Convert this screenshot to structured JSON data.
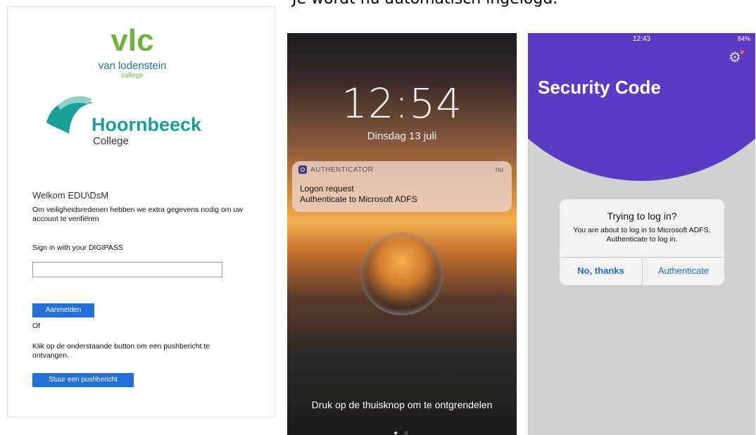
{
  "caption": {
    "text": "Je wordt nu automatisch ingelogd."
  },
  "login": {
    "logo_vlc_main": "vlc",
    "logo_vlc_name": "van lodenstein",
    "logo_vlc_sub": "college",
    "logo_hoorn_main": "Hoornbeeck",
    "logo_hoorn_sub": "College",
    "welcome": "Welkom EDU\\DsM",
    "info": "Om veiligheidsredenen hebben we extra gegevens nodig om uw account te verifiëren",
    "sign_in_label": "Sign in with your DIGIPASS",
    "input_value": "",
    "login_button": "Aanmelden",
    "or": "Of",
    "push_info": "Klik op de onderstaande button om een pushbericht te ontvangen.",
    "push_button": "Stuur een pushbericht"
  },
  "lockscreen": {
    "time": "12:54",
    "date": "Dinsdag 13 juli",
    "notification": {
      "app": "AUTHENTICATOR",
      "time": "nu",
      "title": "Logon request",
      "body": "Authenticate to Microsoft ADFS"
    },
    "unlock_hint": "Druk op de thuisknop om te ontgrendelen",
    "page_dots": "● ○"
  },
  "authenticator": {
    "status_time": "12:43",
    "battery": "84%",
    "title": "Security Code",
    "dialog": {
      "title": "Trying to log in?",
      "message": "You are about to log in to Microsoft ADFS. Authenticate to log in.",
      "no_button": "No, thanks",
      "auth_button": "Authenticate"
    }
  },
  "colors": {
    "vlc_green": "#6fb43f",
    "vlc_blue": "#1f6db5",
    "hoornbeeck_teal": "#1aa09a",
    "primary_button": "#2470d8",
    "auth_purple": "#5a3bc4",
    "ios_blue": "#1b6fd8"
  }
}
